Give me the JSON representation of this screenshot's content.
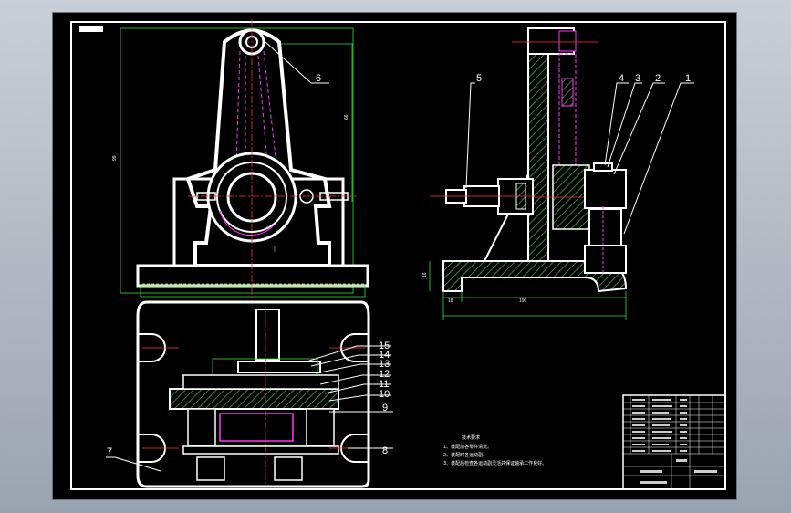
{
  "drawing": {
    "part_labels": [
      "1",
      "2",
      "3",
      "4",
      "5",
      "6",
      "7",
      "8",
      "9",
      "10",
      "11",
      "12",
      "13",
      "14",
      "15"
    ],
    "tech_req_title": "技术要求",
    "tech_req": [
      "1、装配前各零件清洗。",
      "2、装配时各运动副。",
      "3、装配后检查各运动副灵活并保证轴承工作良好。"
    ],
    "dims": [
      "66",
      "18",
      "16",
      "190",
      "99"
    ],
    "colors": {
      "line": "#ffffff",
      "hatch": "#3cb43c",
      "hidden": "#ff33ff",
      "dimension": "#33dd33",
      "center": "#ff3333"
    }
  }
}
